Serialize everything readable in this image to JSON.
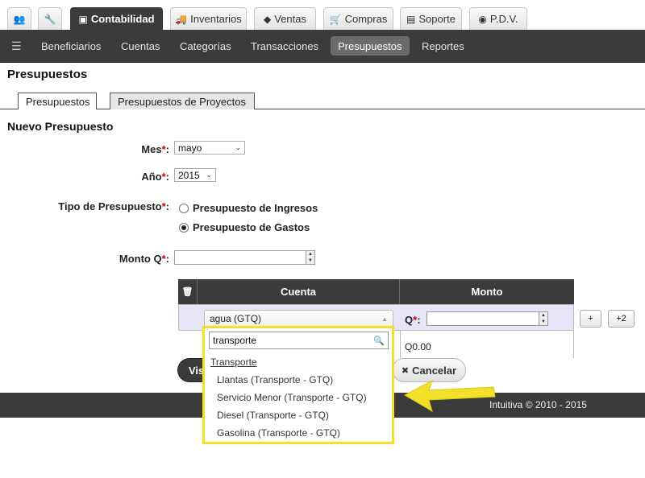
{
  "top_tabs": [
    {
      "label": "",
      "icon": "users-icon"
    },
    {
      "label": "",
      "icon": "wrench-icon"
    },
    {
      "label": "Contabilidad",
      "icon": "money-icon"
    },
    {
      "label": "Inventarios",
      "icon": "truck-icon"
    },
    {
      "label": "Ventas",
      "icon": "tag-icon"
    },
    {
      "label": "Compras",
      "icon": "cart-icon"
    },
    {
      "label": "Soporte",
      "icon": "briefcase-icon"
    },
    {
      "label": "P.D.V.",
      "icon": "target-icon"
    }
  ],
  "submenu": {
    "items": [
      "Beneficiarios",
      "Cuentas",
      "Categorías",
      "Transacciones",
      "Presupuestos",
      "Reportes"
    ],
    "active": "Presupuestos"
  },
  "page_title": "Presupuestos",
  "sub_tabs": [
    "Presupuestos",
    "Presupuestos de Proyectos"
  ],
  "form": {
    "title": "Nuevo Presupuesto",
    "mes_label": "Mes",
    "mes_value": "mayo",
    "anio_label": "Año",
    "anio_value": "2015",
    "tipo_label": "Tipo de Presupuesto",
    "tipo_ingresos": "Presupuesto de Ingresos",
    "tipo_gastos": "Presupuesto de Gastos",
    "tipo_selected": "Presupuesto de Gastos",
    "monto_label": "Monto Q",
    "monto_value": "",
    "required_mark": "*",
    "colon": ":"
  },
  "table": {
    "headers": [
      "",
      "Cuenta",
      "Monto"
    ],
    "row": {
      "cuenta_value": "agua (GTQ)",
      "q_label": "Q",
      "monto_value": "",
      "subtotal": "Q0.00"
    },
    "add_button": "+",
    "add2_button": "+2"
  },
  "buttons": {
    "guardar_partial": "Vis",
    "cancelar": "Cancelar"
  },
  "dropdown": {
    "search_value": "transporte",
    "group": "Transporte",
    "options": [
      "Llantas (Transporte - GTQ)",
      "Servicio Menor (Transporte - GTQ)",
      "Diesel (Transporte - GTQ)",
      "Gasolina (Transporte - GTQ)"
    ]
  },
  "footer": "Intuitiva © 2010 - 2015",
  "colors": {
    "highlight": "#f2e02b",
    "dark": "#3b3b3b"
  }
}
